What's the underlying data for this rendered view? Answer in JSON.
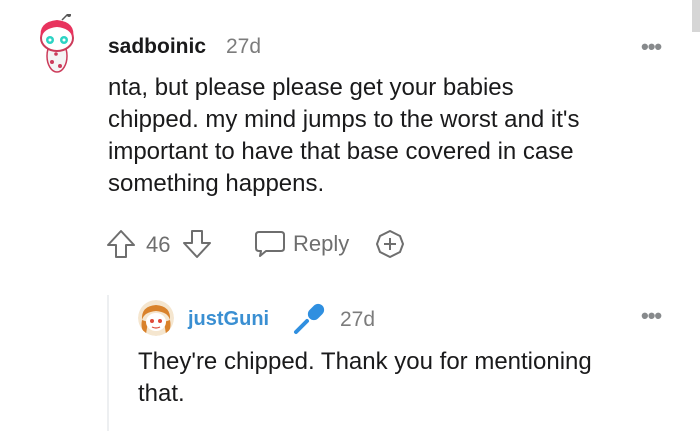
{
  "comment": {
    "username": "sadboinic",
    "time": "27d",
    "more_icon": "more-dots-icon",
    "body_lines": [
      "nta, but please please get your babies",
      "chipped. my mind jumps to the worst and it's",
      "important to have that base covered in case",
      "something happens."
    ],
    "score": "46",
    "reply_label": "Reply"
  },
  "reply": {
    "username": "justGuni",
    "time": "27d",
    "badge_icon": "microphone-icon",
    "body_lines": [
      "They're chipped. Thank you for mentioning",
      "that."
    ]
  },
  "colors": {
    "username_link": "#3a8fd2",
    "muted": "#7c7c7c",
    "text": "#1a1a1b"
  }
}
